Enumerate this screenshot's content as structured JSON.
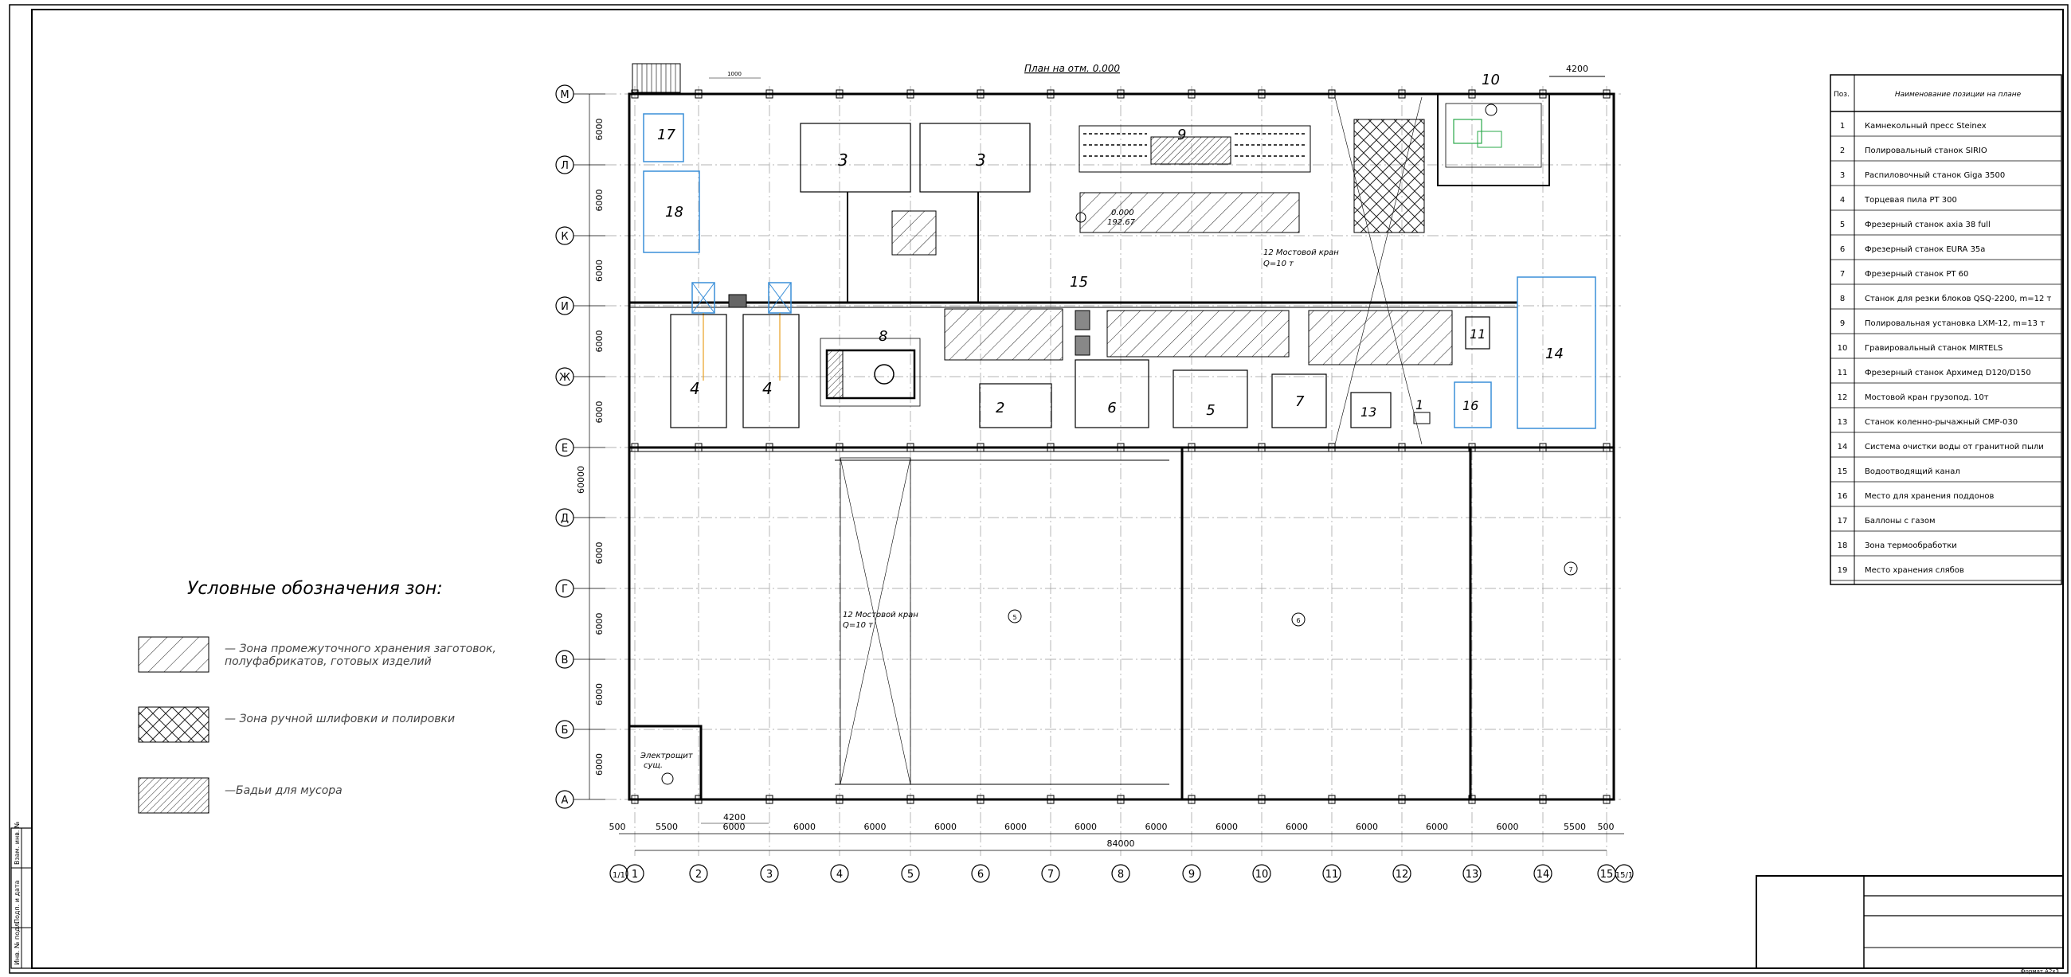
{
  "plan": {
    "title": "План на отм. 0.000",
    "level_mark_1": "0.000",
    "level_mark_2": "192.67",
    "crane_label_1": "12  Мостовой кран",
    "crane_load_1": "Q=10 т",
    "crane_label_2": "12  Мостовой кран",
    "crane_load_2": "Q=10 т",
    "electro_room_1": "Электрощит",
    "electro_room_2": "сущ.",
    "top_dim": "4200",
    "top_left_dim": "1000"
  },
  "axes": {
    "rows": [
      "М",
      "Л",
      "К",
      "И",
      "Ж",
      "Е",
      "Д",
      "Г",
      "В",
      "Б",
      "А"
    ],
    "row_dims": [
      "6000",
      "6000",
      "6000",
      "6000",
      "6000",
      "60000",
      "6000",
      "6000",
      "6000",
      "6000"
    ],
    "cols": [
      "1/1",
      "1",
      "2",
      "3",
      "4",
      "5",
      "6",
      "7",
      "8",
      "9",
      "10",
      "11",
      "12",
      "13",
      "14",
      "15",
      "15/1"
    ],
    "col_dims": [
      "500",
      "5500",
      "6000",
      "6000",
      "6000",
      "6000",
      "6000",
      "6000",
      "6000",
      "6000",
      "6000",
      "6000",
      "6000",
      "6000",
      "5500",
      "500"
    ],
    "total_dim": "84000",
    "bottom_mid_dim": "4200"
  },
  "zone_labels": [
    "17",
    "18",
    "3",
    "3",
    "9",
    "15",
    "8",
    "4",
    "4",
    "2",
    "6",
    "5",
    "7",
    "13",
    "1",
    "11",
    "16",
    "14",
    "10"
  ],
  "zone_circles": [
    "5",
    "6",
    "7",
    "5"
  ],
  "legend": {
    "title": "Условные обозначения зон:",
    "items": [
      {
        "line1": "— Зона промежуточного хранения заготовок,",
        "line2": "полуфабрикатов, готовых изделий"
      },
      {
        "line1": "— Зона ручной шлифовки и полировки",
        "line2": ""
      },
      {
        "line1": "—Бадьи для мусора",
        "line2": ""
      }
    ]
  },
  "table": {
    "header_pos": "Поз.",
    "header_name": "Наименование позиции на плане",
    "rows": [
      {
        "pos": "1",
        "name": "Камнекольный пресс Steinex"
      },
      {
        "pos": "2",
        "name": "Полировальный станок SIRIO"
      },
      {
        "pos": "3",
        "name": "Распиловочный станок Giga 3500"
      },
      {
        "pos": "4",
        "name": "Торцевая пила PT 300"
      },
      {
        "pos": "5",
        "name": "Фрезерный станок axia 38 full"
      },
      {
        "pos": "6",
        "name": "Фрезерный станок EURA 35a"
      },
      {
        "pos": "7",
        "name": "Фрезерный станок PT 60"
      },
      {
        "pos": "8",
        "name": "Станок для резки блоков QSQ-2200, m=12 т"
      },
      {
        "pos": "9",
        "name": "Полировальная установка LXM-12, m=13 т"
      },
      {
        "pos": "10",
        "name": "Гравировальный станок MIRTELS"
      },
      {
        "pos": "11",
        "name": "Фрезерный станок Архимед D120/D150"
      },
      {
        "pos": "12",
        "name": "Мостовой кран грузопод. 10т"
      },
      {
        "pos": "13",
        "name": "Станок коленно-рычажный СМР-030"
      },
      {
        "pos": "14",
        "name": "Система очистки воды от гранитной пыли"
      },
      {
        "pos": "15",
        "name": "Водоотводящий канал"
      },
      {
        "pos": "16",
        "name": "Место для хранения поддонов"
      },
      {
        "pos": "17",
        "name": "Баллоны с газом"
      },
      {
        "pos": "18",
        "name": "Зона термообработки"
      },
      {
        "pos": "19",
        "name": "Место хранения слябов"
      }
    ]
  },
  "stamp": {
    "side_1": "Инв. № подл.",
    "side_2": "Подп. и дата",
    "side_3": "Взам. инв. №",
    "format": "Формат А2x3"
  },
  "colors": {
    "line": "#000000",
    "blue": "#3a8fd8",
    "grid": "#9a9a9a"
  }
}
